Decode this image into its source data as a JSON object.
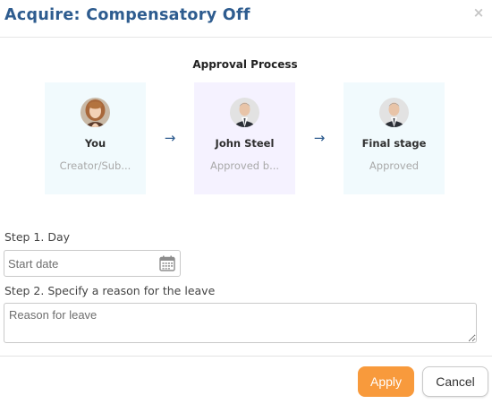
{
  "dialog": {
    "title": "Acquire: Compensatory Off",
    "close_icon": "close-icon",
    "close_glyph": "×"
  },
  "approval": {
    "title": "Approval Process",
    "stages": [
      {
        "name": "You",
        "subtitle": "Creator/Sub...",
        "avatar": "avatar-woman",
        "background": "#f1fafd"
      },
      {
        "name": "John Steel",
        "subtitle": "Approved b...",
        "avatar": "avatar-man",
        "background": "#f5f2ff"
      },
      {
        "name": "Final stage",
        "subtitle": "Approved",
        "avatar": "avatar-man",
        "background": "#f1fafd"
      }
    ],
    "arrow_glyph": "→"
  },
  "form": {
    "step1_label": "Step 1. Day",
    "date_placeholder": "Start date",
    "step2_label": "Step 2. Specify a reason for the leave",
    "reason_placeholder": "Reason for leave",
    "calendar_icon": "calendar-icon"
  },
  "footer": {
    "apply_label": "Apply",
    "cancel_label": "Cancel"
  },
  "colors": {
    "title": "#2e5c8f",
    "accent_orange": "#f89a3c",
    "arrow": "#2e5c8f"
  }
}
